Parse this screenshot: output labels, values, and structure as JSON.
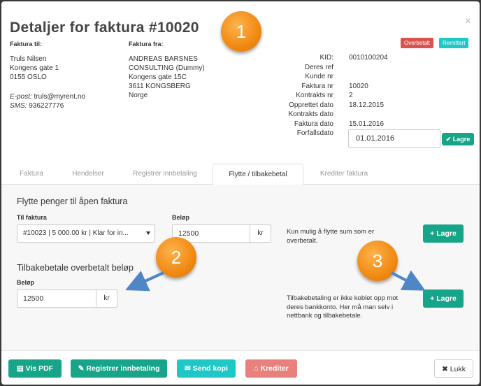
{
  "header": {
    "title": "Detaljer for faktura #10020",
    "close": "×",
    "badges": [
      "Overbetalt",
      "Remittert"
    ]
  },
  "to": {
    "label": "Faktura til:",
    "name": "Truls Nilsen",
    "address1": "Kongens gate 1",
    "address2": "0155 OSLO",
    "email_label": "E-post:",
    "email": "truls@myrent.no",
    "sms_label": "SMS:",
    "sms": "936227776"
  },
  "from": {
    "label": "Faktura fra:",
    "line1": "ANDREAS BARSNES",
    "line2": "CONSULTING (Dummy)",
    "line3": "Kongens gate 15C",
    "line4": "3611 KONGSBERG",
    "line5": "Norge"
  },
  "details": {
    "keys": [
      "KID:",
      "Deres ref",
      "Kunde nr",
      "Faktura nr",
      "Kontrakts nr",
      "Opprettet dato",
      "Kontrakts dato",
      "Faktura dato",
      "Forfallsdato"
    ],
    "values": [
      "0010100204",
      "",
      "",
      "10020",
      "2",
      "18.12.2015",
      "",
      "15.01.2016"
    ],
    "due_date": "01.01.2016",
    "save": "Lagre"
  },
  "tabs": [
    "Faktura",
    "Hendelser",
    "Registrer innbetaling",
    "Flytte / tilbakebetal",
    "Krediter faktura"
  ],
  "move": {
    "title": "Flytte penger til åpen faktura",
    "to_label": "Til faktura",
    "to_value": "#10023 | 5 000.00 kr | Klar for in...",
    "amount_label": "Beløp",
    "amount": "12500",
    "currency": "kr",
    "note": "Kun mulig å flytte sum som er overbetalt.",
    "save": "Lagre"
  },
  "refund": {
    "title": "Tilbakebetale overbetalt beløp",
    "amount_label": "Beløp",
    "amount": "12500",
    "currency": "kr",
    "note": "Tilbakebetaling er ikke koblet opp mot deres bankkonto. Her må man selv i nettbank og tilbakebetale.",
    "save": "Lagre"
  },
  "footer": {
    "pdf": "Vis PDF",
    "register": "Registrer innbetaling",
    "send": "Send kopi",
    "credit": "Krediter",
    "close": "Lukk"
  },
  "callouts": [
    "1",
    "2",
    "3"
  ],
  "colors": {
    "green": "#17a589",
    "teal": "#1fc7c7",
    "red": "#d9534f",
    "salmon": "#e8817c",
    "orange": "#f08a12",
    "arrow": "#4f86c6"
  }
}
